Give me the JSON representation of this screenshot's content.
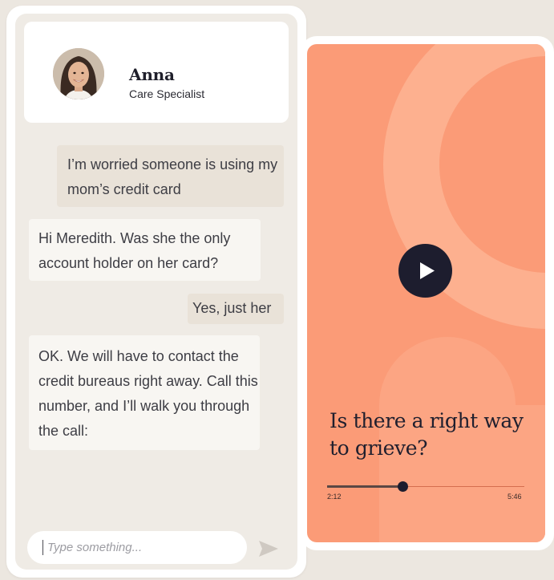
{
  "agent": {
    "name": "Anna",
    "role": "Care Specialist"
  },
  "messages": [
    {
      "sender": "user",
      "text": "I’m worried someone is using my mom’s credit card"
    },
    {
      "sender": "agent",
      "text": "Hi Meredith. Was she the only account holder on her card?"
    },
    {
      "sender": "user",
      "text": "Yes, just her"
    },
    {
      "sender": "agent",
      "text": "OK. We will have to contact the credit bureaus right away. Call this number, and I’ll walk you through the call:"
    }
  ],
  "composer": {
    "placeholder": "Type something..."
  },
  "video": {
    "title": "Is there a right way to grieve?",
    "current_time": "2:12",
    "total_time": "5:46",
    "progress_fraction": 0.382
  },
  "colors": {
    "video_panel": "#fb9b77",
    "chat_background": "#efebe5",
    "user_bubble": "#e9e2d8",
    "agent_bubble": "#f8f6f2",
    "play_button": "#1d1d2e"
  },
  "icons": {
    "send": "send-icon",
    "play": "play-icon"
  }
}
